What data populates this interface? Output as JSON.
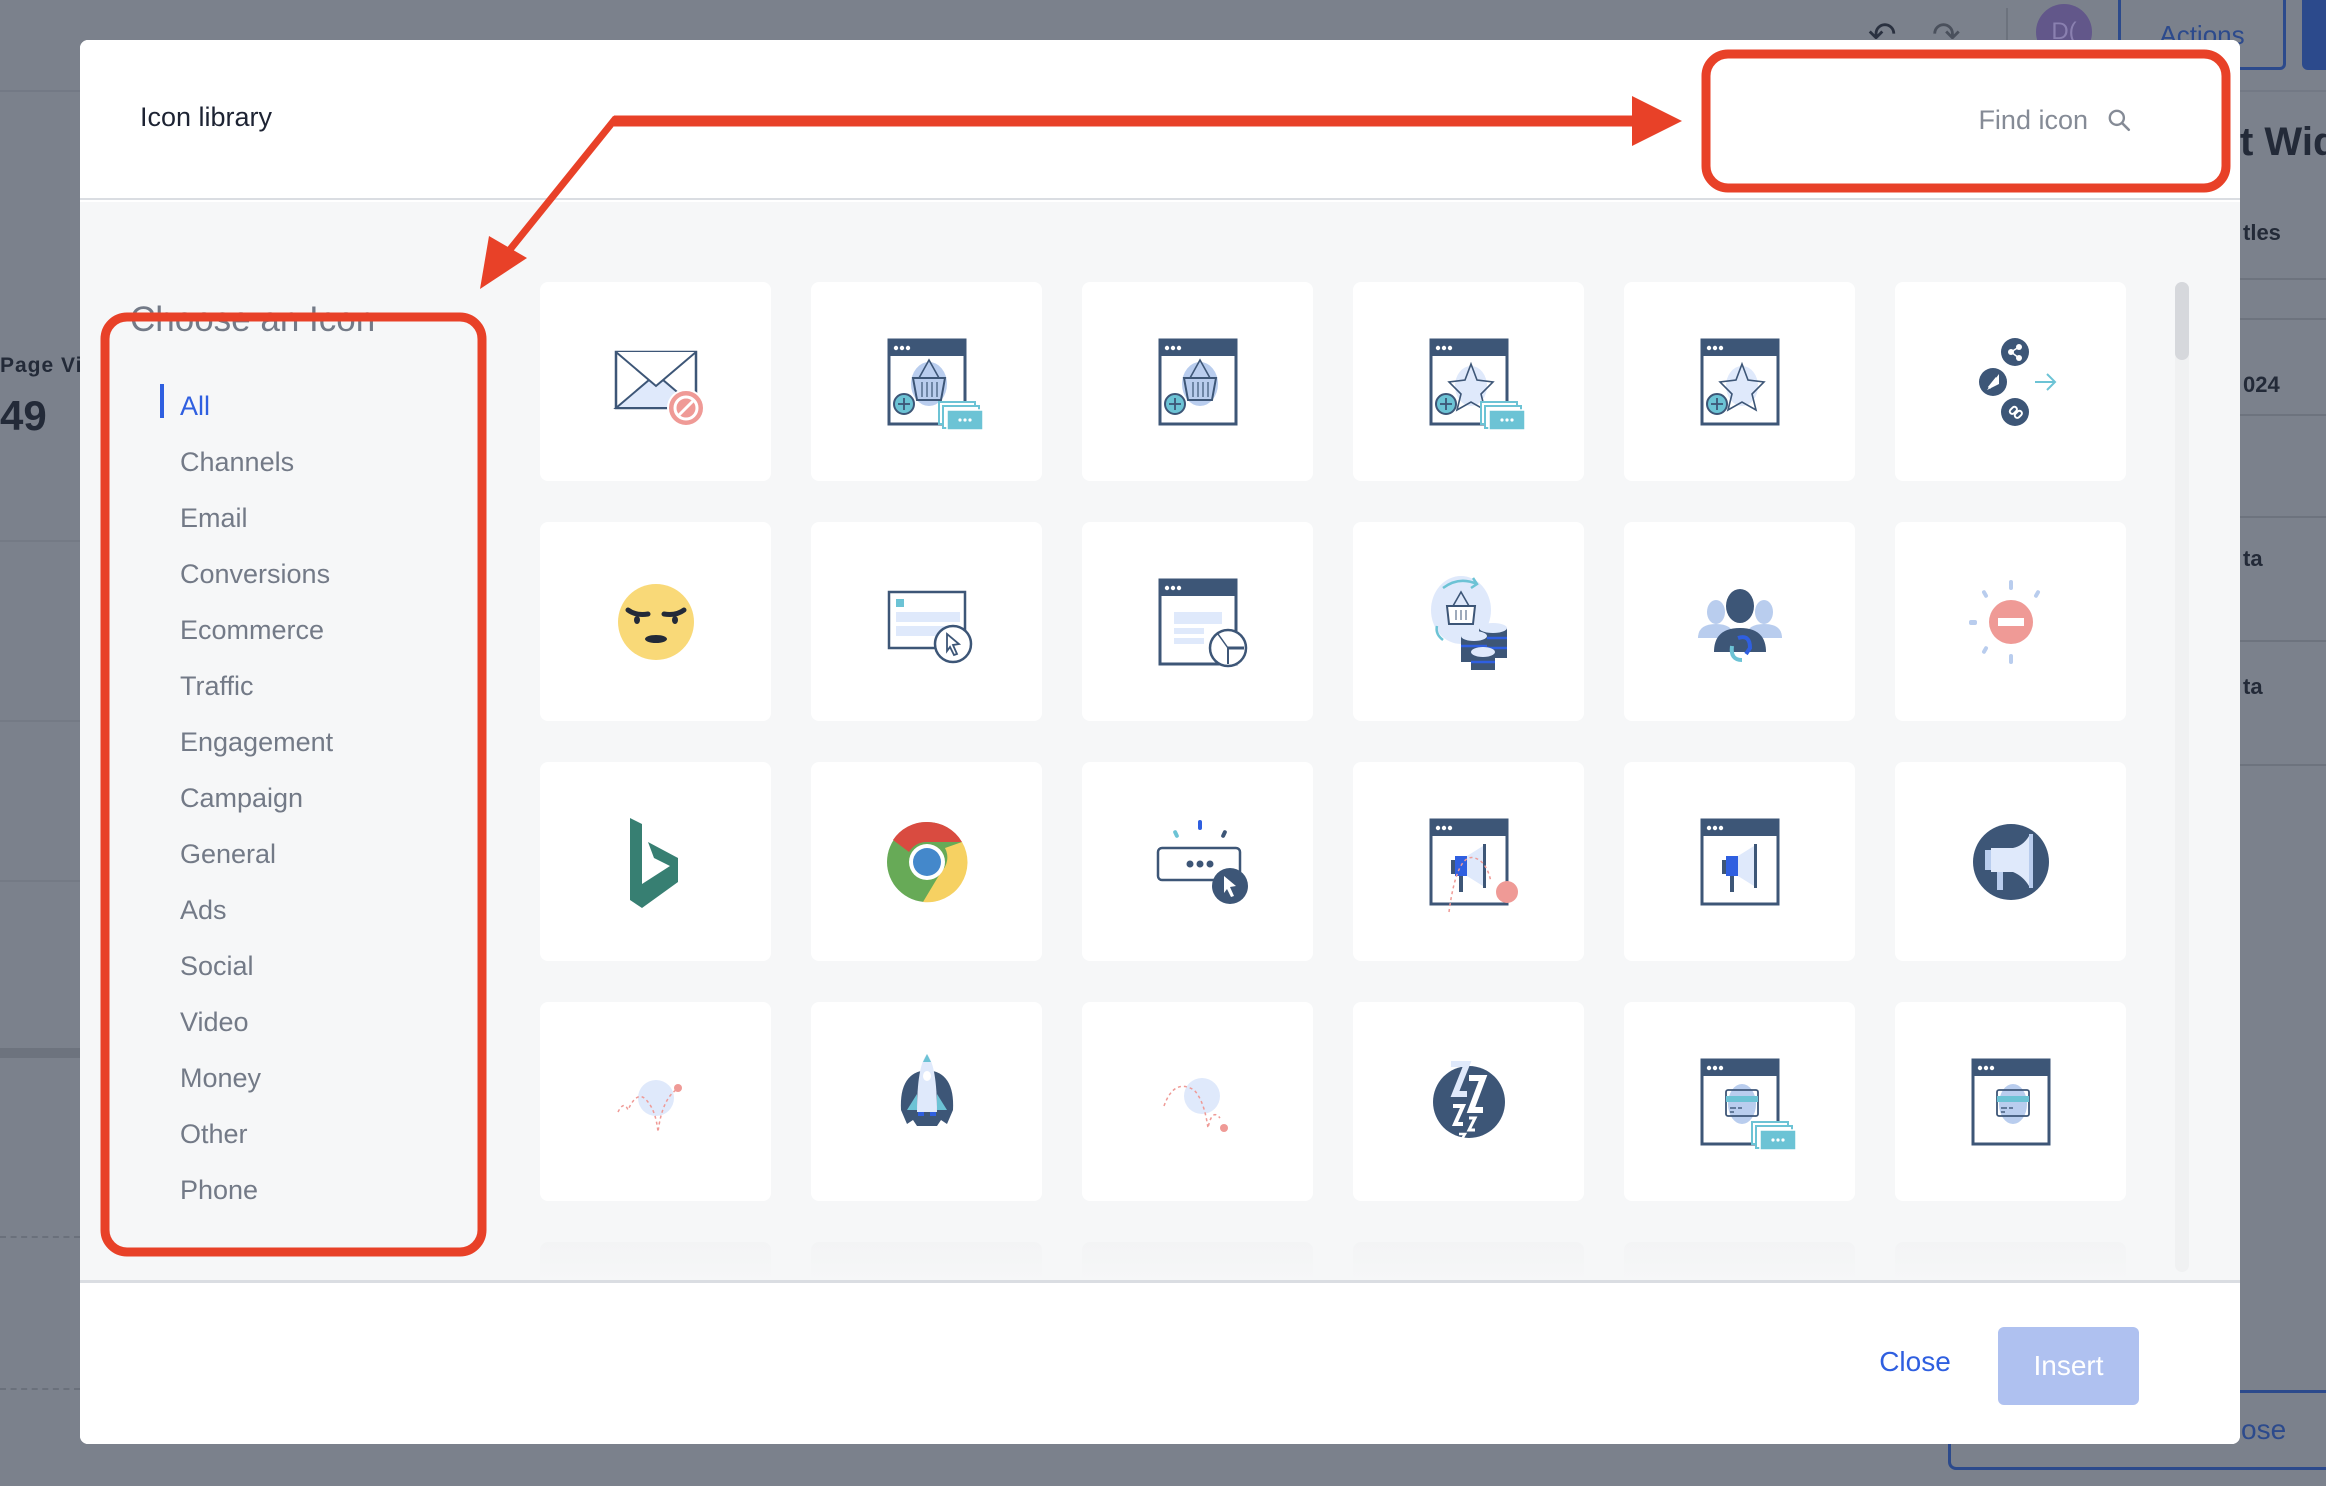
{
  "background": {
    "left_panel": {
      "label": "Page Vi",
      "value": "49"
    },
    "right_panel": {
      "title": "t Widg",
      "rows": [
        "tles",
        "024",
        "ta",
        "ta"
      ],
      "close_label": "ose"
    },
    "topbar": {
      "avatar_initials": "D(",
      "actions_label": "Actions"
    }
  },
  "modal": {
    "title": "Icon library",
    "search": {
      "placeholder": "Find icon",
      "value": ""
    },
    "sidebar": {
      "heading": "Choose an Icon",
      "categories": [
        {
          "label": "All",
          "active": true
        },
        {
          "label": "Channels",
          "active": false
        },
        {
          "label": "Email",
          "active": false
        },
        {
          "label": "Conversions",
          "active": false
        },
        {
          "label": "Ecommerce",
          "active": false
        },
        {
          "label": "Traffic",
          "active": false
        },
        {
          "label": "Engagement",
          "active": false
        },
        {
          "label": "Campaign",
          "active": false
        },
        {
          "label": "General",
          "active": false
        },
        {
          "label": "Ads",
          "active": false
        },
        {
          "label": "Social",
          "active": false
        },
        {
          "label": "Video",
          "active": false
        },
        {
          "label": "Money",
          "active": false
        },
        {
          "label": "Other",
          "active": false
        },
        {
          "label": "Phone",
          "active": false
        }
      ]
    },
    "icons": [
      "email-blocked-icon",
      "browser-basket-add-tickets-icon",
      "browser-basket-add-icon",
      "browser-star-add-tickets-icon",
      "browser-star-add-icon",
      "share-click-link-icon",
      "angry-face-icon",
      "form-click-icon",
      "browser-form-clock-icon",
      "basket-coins-cycle-icon",
      "user-group-refresh-icon",
      "alert-stop-icon",
      "bing-logo-icon",
      "chrome-logo-icon",
      "button-click-icon",
      "browser-megaphone-bounce-icon",
      "browser-megaphone-icon",
      "megaphone-circle-icon",
      "bounce-up-icon",
      "rocket-launch-icon",
      "bounce-down-icon",
      "sleep-zzz-icon",
      "browser-card-tickets-icon",
      "browser-card-icon"
    ],
    "footer": {
      "close_label": "Close",
      "insert_label": "Insert",
      "insert_disabled": true
    }
  },
  "colors": {
    "accent": "#2f5fe0",
    "navy": "#3d5677",
    "teal": "#6cc3d5",
    "light_blue": "#dfe9fb",
    "pale_blue": "#b9cdee",
    "coral": "#ef9a96",
    "annotation_red": "#e84128",
    "overlay": "#7b818c"
  }
}
